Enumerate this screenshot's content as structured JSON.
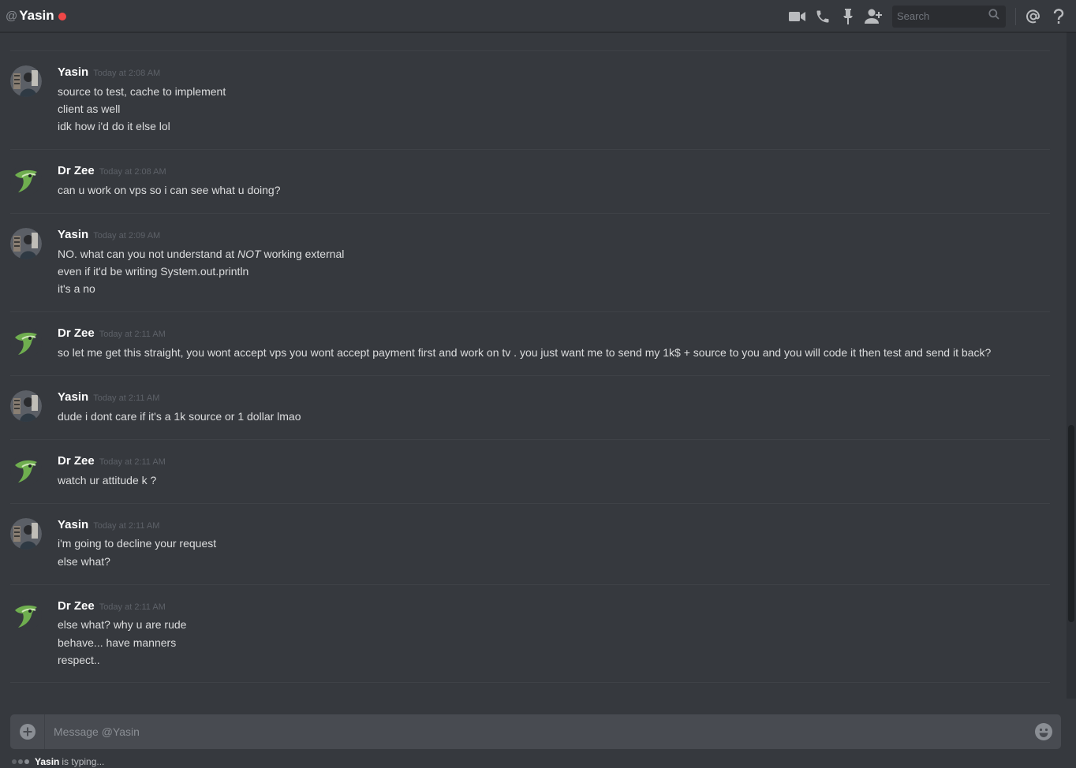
{
  "header": {
    "at_symbol": "@",
    "title": "Yasin",
    "status_color": "#f04747",
    "search_placeholder": "Search",
    "icons": [
      "video-call-icon",
      "voice-call-icon",
      "pin-icon",
      "add-friend-icon",
      "search-icon",
      "mention-icon",
      "help-icon"
    ]
  },
  "colors": {
    "background": "#36393e",
    "username": "#ffffff",
    "text": "#dcddde",
    "timestamp": "#5d6168"
  },
  "messages": [
    {
      "author": "Yasin",
      "time": "Today at 2:08 AM",
      "lines": [
        "source to test, cache to implement",
        "client as well",
        "idk how i'd do it else lol"
      ]
    },
    {
      "author": "Dr Zee",
      "time": "Today at 2:08 AM",
      "lines": [
        "can u work on vps so i can see what u doing?"
      ]
    },
    {
      "author": "Yasin",
      "time": "Today at 2:09 AM",
      "lines": [
        "NO. what can you not understand at ",
        "NOT",
        " working external",
        "even if it'd be writing System.out.println",
        "it's a no"
      ]
    },
    {
      "author": "Dr Zee",
      "time": "Today at 2:11 AM",
      "lines": [
        "so let me get this straight,  you wont accept vps you wont accept payment first and work on tv  . you just want me to send my 1k$ + source to you and you will code it then test and send it back?"
      ]
    },
    {
      "author": "Yasin",
      "time": "Today at 2:11 AM",
      "lines": [
        "dude i dont care if it's a 1k source or 1 dollar lmao"
      ]
    },
    {
      "author": "Dr Zee",
      "time": "Today at 2:11 AM",
      "lines": [
        "watch ur attitude k ?"
      ]
    },
    {
      "author": "Yasin",
      "time": "Today at 2:11 AM",
      "lines": [
        "i'm going to decline your request",
        "else what?"
      ]
    },
    {
      "author": "Dr Zee",
      "time": "Today at 2:11 AM",
      "lines": [
        "else what? why u are rude",
        "behave... have manners",
        "respect.."
      ]
    }
  ],
  "composer": {
    "placeholder": "Message @Yasin"
  },
  "typing": {
    "user": "Yasin",
    "text": "is typing..."
  }
}
